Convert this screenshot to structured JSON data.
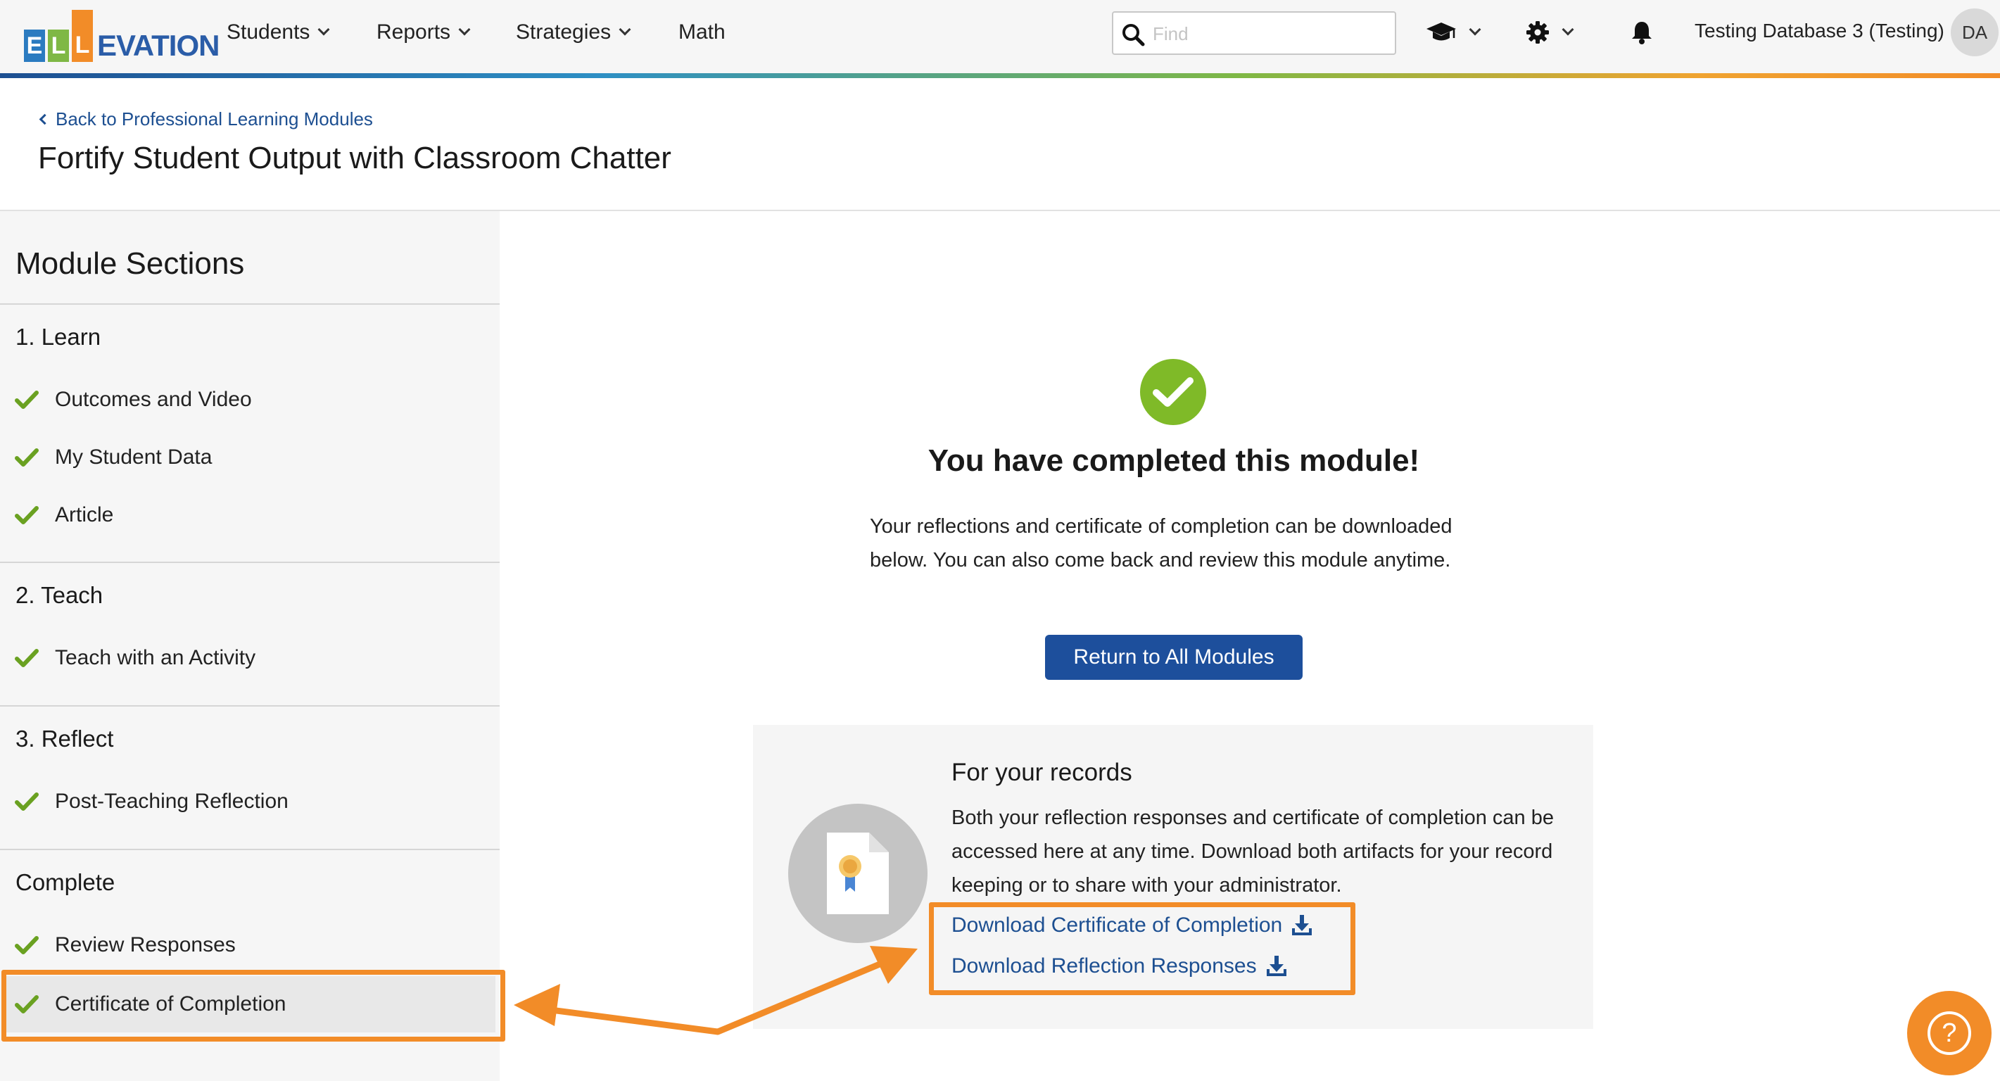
{
  "nav": {
    "logo": {
      "letters": [
        "E",
        "L",
        "L"
      ],
      "rest": "EVATION"
    },
    "menu": [
      {
        "label": "Students",
        "has_dropdown": true
      },
      {
        "label": "Reports",
        "has_dropdown": true
      },
      {
        "label": "Strategies",
        "has_dropdown": true
      },
      {
        "label": "Math",
        "has_dropdown": false
      }
    ],
    "search_placeholder": "Find",
    "search_value": "",
    "icons": [
      "graduation-cap-icon",
      "gear-icon",
      "bell-icon"
    ],
    "user_label": "Testing Database 3 (Testing)",
    "avatar_initials": "DA"
  },
  "header": {
    "back_link": "Back to Professional Learning Modules",
    "title": "Fortify Student Output with Classroom Chatter"
  },
  "sidebar": {
    "title": "Module Sections",
    "sections": [
      {
        "heading": "1. Learn",
        "items": [
          {
            "label": "Outcomes and Video",
            "completed": true
          },
          {
            "label": "My Student Data",
            "completed": true
          },
          {
            "label": "Article",
            "completed": true
          }
        ]
      },
      {
        "heading": "2. Teach",
        "items": [
          {
            "label": "Teach with an Activity",
            "completed": true
          }
        ]
      },
      {
        "heading": "3. Reflect",
        "items": [
          {
            "label": "Post-Teaching Reflection",
            "completed": true
          }
        ]
      },
      {
        "heading": "Complete",
        "items": [
          {
            "label": "Review Responses",
            "completed": true
          },
          {
            "label": "Certificate of Completion",
            "completed": true,
            "active": true
          }
        ]
      }
    ]
  },
  "main": {
    "completed_title": "You have completed this module!",
    "completed_text": "Your reflections and certificate of completion can be downloaded below. You can also come back and review this module anytime.",
    "return_button": "Return to All Modules",
    "records": {
      "title": "For your records",
      "text": "Both your reflection responses and certificate of completion can be accessed here at any time. Download both artifacts for your record keeping or to share with your administrator.",
      "links": [
        {
          "label": "Download Certificate of Completion",
          "icon": "download-icon"
        },
        {
          "label": "Download Reflection Responses",
          "icon": "download-icon"
        }
      ]
    }
  },
  "help_button": {
    "icon": "help-icon",
    "glyph": "?"
  },
  "colors": {
    "brand_blue": "#1d4f91",
    "button_blue": "#1d4f9c",
    "check_green": "#7fba28",
    "highlight_orange": "#f28c28"
  }
}
